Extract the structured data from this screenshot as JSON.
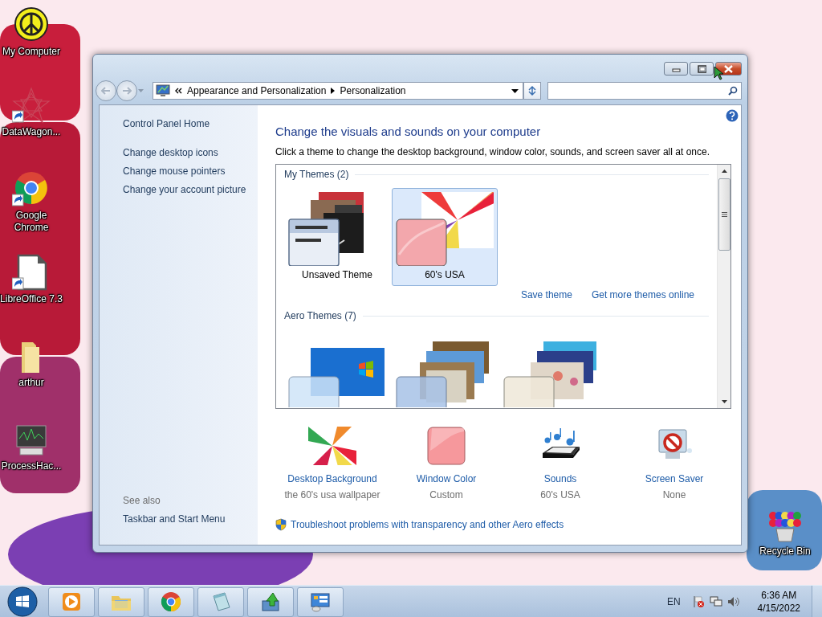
{
  "desktop_icons": [
    {
      "label": "My Computer",
      "kind": "peace",
      "shortcut": false
    },
    {
      "label": "DataWagon...",
      "kind": "star",
      "shortcut": true
    },
    {
      "label": "Google Chrome",
      "kind": "chrome",
      "shortcut": true
    },
    {
      "label": "LibreOffice 7.3",
      "kind": "document",
      "shortcut": true
    },
    {
      "label": "arthur",
      "kind": "folder",
      "shortcut": false
    },
    {
      "label": "ProcessHac...",
      "kind": "monitor",
      "shortcut": false
    }
  ],
  "recycle_bin": {
    "label": "Recycle Bin"
  },
  "window": {
    "address_path": [
      "Appearance and Personalization",
      "Personalization"
    ]
  },
  "sidebar": {
    "links": [
      "Control Panel Home",
      "Change desktop icons",
      "Change mouse pointers",
      "Change your account picture"
    ],
    "see_also_heading": "See also",
    "see_also": [
      "Taskbar and Start Menu"
    ]
  },
  "main": {
    "heading": "Change the visuals and sounds on your computer",
    "description": "Click a theme to change the desktop background, window color, sounds, and screen saver all at once.",
    "theme_groups": [
      {
        "title": "My Themes (2)",
        "themes": [
          {
            "name": "Unsaved Theme",
            "kind": "custom",
            "selected": false
          },
          {
            "name": "60's USA",
            "kind": "tiedye",
            "selected": true
          }
        ]
      },
      {
        "title": "Aero Themes (7)",
        "themes": [
          {
            "kind": "windows",
            "selected": false
          },
          {
            "kind": "architecture",
            "selected": false
          },
          {
            "kind": "nature",
            "selected": false
          }
        ]
      }
    ],
    "theme_links": [
      "Save theme",
      "Get more themes online"
    ],
    "settings": [
      {
        "kind": "background",
        "label": "Desktop Background",
        "value": "the 60's usa wallpaper"
      },
      {
        "kind": "color",
        "label": "Window Color",
        "value": "Custom"
      },
      {
        "kind": "sounds",
        "label": "Sounds",
        "value": "60's USA"
      },
      {
        "kind": "screensaver",
        "label": "Screen Saver",
        "value": "None"
      }
    ],
    "troubleshoot_link": "Troubleshoot problems with transparency and other Aero effects"
  },
  "taskbar": {
    "buttons": [
      {
        "kind": "media"
      },
      {
        "kind": "explorer"
      },
      {
        "kind": "chrome"
      },
      {
        "kind": "notepad"
      },
      {
        "kind": "install"
      },
      {
        "kind": "control-panel"
      }
    ],
    "language": "EN",
    "time": "6:36 AM",
    "date": "4/15/2022"
  }
}
